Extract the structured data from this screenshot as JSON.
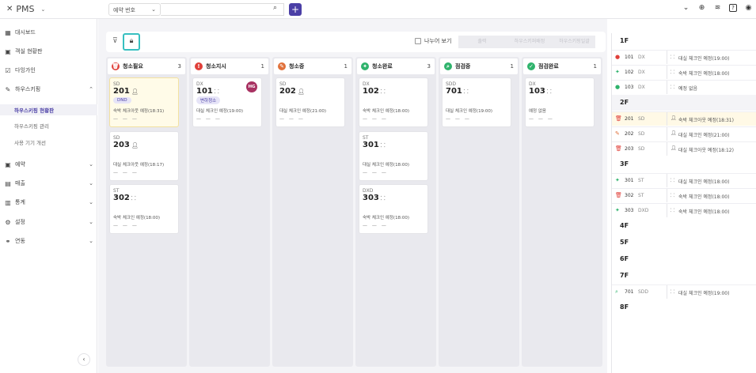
{
  "app": {
    "title": "PMS"
  },
  "search": {
    "field_label": "예약 번호",
    "value": ""
  },
  "colors": {
    "accent": "#4b3fa6",
    "highlight_border": "#37bfc0",
    "red": "#e0403a",
    "green": "#2fb36c"
  },
  "sidebar": {
    "items": [
      {
        "label": "대시보드",
        "icon": "dashboard-icon"
      },
      {
        "label": "객실 현황판",
        "icon": "calendar-icon"
      },
      {
        "label": "다잉가인",
        "icon": "calendar-check-icon"
      },
      {
        "label": "하우스키핑",
        "icon": "broom-icon"
      },
      {
        "label": "예약",
        "icon": "calendar-icon"
      },
      {
        "label": "매출",
        "icon": "document-icon"
      },
      {
        "label": "통계",
        "icon": "chart-icon"
      },
      {
        "label": "설정",
        "icon": "gear-icon"
      },
      {
        "label": "연동",
        "icon": "link-icon"
      }
    ],
    "sub_items": [
      "하우스키핑 현황판",
      "하우스키핑 관리",
      "사용 기기 개선"
    ]
  },
  "toolbar": {
    "split_label": "나누어 보기",
    "btn1": "출력",
    "btn2": "하우스키퍼배정",
    "btn3": "하우스키핑일괄"
  },
  "columns": [
    {
      "title": "청소필요",
      "count": "3",
      "cards": [
        {
          "type": "SD",
          "room": "201",
          "tag": "DND",
          "note": "숙박 체크아웃 예정(18:31)",
          "dash": "— — —"
        },
        {
          "type": "SD",
          "room": "203",
          "note": "대실 체크아웃 예정(18:17)",
          "dash": "— — —"
        },
        {
          "type": "ST",
          "room": "302",
          "note": "숙박 체크인 예정(18:00)",
          "dash": "— — —"
        }
      ]
    },
    {
      "title": "청소지시",
      "count": "1",
      "cards": [
        {
          "type": "DX",
          "room": "101",
          "tag": "변하청소",
          "avatar": "HG",
          "note": "대실 체크인 예정(19:00)",
          "dash": "— — —"
        }
      ]
    },
    {
      "title": "청소중",
      "count": "1",
      "cards": [
        {
          "type": "SD",
          "room": "202",
          "note": "대실 체크인 예정(21:00)",
          "dash": "— — —"
        }
      ]
    },
    {
      "title": "청소완료",
      "count": "3",
      "cards": [
        {
          "type": "DX",
          "room": "102",
          "note": "숙박 체크인 예정(18:00)",
          "dash": "— — —"
        },
        {
          "type": "ST",
          "room": "301",
          "note": "대실 체크인 예정(18:00)",
          "dash": "— — —"
        },
        {
          "type": "DXD",
          "room": "303",
          "note": "숙박 체크인 예정(18:00)",
          "dash": "— — —"
        }
      ]
    },
    {
      "title": "점검중",
      "count": "1",
      "cards": [
        {
          "type": "SDD",
          "room": "701",
          "note": "대실 체크인 예정(19:00)",
          "dash": "— — —"
        }
      ]
    },
    {
      "title": "점검완료",
      "count": "1",
      "cards": [
        {
          "type": "DX",
          "room": "103",
          "note": "예정 없음",
          "dash": "— — —"
        }
      ]
    }
  ],
  "floors": [
    {
      "label": "1F",
      "rooms": [
        {
          "no": "101",
          "type": "DX",
          "note": "대실 체크인 예정(19:00)"
        },
        {
          "no": "102",
          "type": "DX",
          "note": "숙박 체크인 예정(18:00)"
        },
        {
          "no": "103",
          "type": "DX",
          "note": "예정 없음"
        }
      ]
    },
    {
      "label": "2F",
      "rooms": [
        {
          "no": "201",
          "type": "SD",
          "note": "숙박 체크아웃 예정(18:31)"
        },
        {
          "no": "202",
          "type": "SD",
          "note": "대실 체크인 예정(21:00)"
        },
        {
          "no": "203",
          "type": "SD",
          "note": "대실 체크아웃 예정(18:12)"
        }
      ]
    },
    {
      "label": "3F",
      "rooms": [
        {
          "no": "301",
          "type": "ST",
          "note": "대실 체크인 예정(18:00)"
        },
        {
          "no": "302",
          "type": "ST",
          "note": "숙박 체크인 예정(18:00)"
        },
        {
          "no": "303",
          "type": "DXD",
          "note": "숙박 체크인 예정(18:00)"
        }
      ]
    },
    {
      "label": "4F",
      "rooms": []
    },
    {
      "label": "5F",
      "rooms": []
    },
    {
      "label": "6F",
      "rooms": []
    },
    {
      "label": "7F",
      "rooms": [
        {
          "no": "701",
          "type": "SDD",
          "note": "대실 체크인 예정(19:00)"
        }
      ]
    },
    {
      "label": "8F",
      "rooms": []
    }
  ]
}
